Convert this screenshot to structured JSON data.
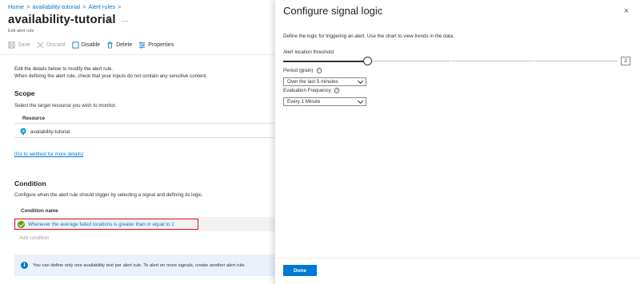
{
  "breadcrumb": {
    "items": [
      "Home",
      "availability-tutorial",
      "Alert rules"
    ],
    "sep": ">"
  },
  "page": {
    "title": "availability-tutorial",
    "subtitle": "Edit alert rule",
    "pin_icon": "pin-icon",
    "more_icon": "ellipsis-icon",
    "more_label": "···"
  },
  "toolbar": {
    "save_label": "Save",
    "discard_label": "Discard",
    "disable_label": "Disable",
    "delete_label": "Delete",
    "properties_label": "Properties"
  },
  "intro": {
    "line1": "Edit the details below to modify the alert rule.",
    "line2": "When defining the alert rule, check that your inputs do not contain any sensitive content."
  },
  "scope": {
    "heading": "Scope",
    "description": "Select the target resource you wish to monitor.",
    "resource_header": "Resource",
    "resource_name": "availability-tutorial",
    "resource_icon": "app-insights-icon"
  },
  "webtest_link": "[Go to webtest for more details]",
  "condition": {
    "heading": "Condition",
    "description": "Configure when the alert rule should trigger by selecting a signal and defining its logic.",
    "column_header": "Condition name",
    "row_text": "Whenever the average failed locations is greater than or equal to 2",
    "add_label": "Add condition"
  },
  "info_bar": {
    "text": "You can define only one availability test per alert rule. To alert on more signals, create another alert rule."
  },
  "panel": {
    "title": "Configure signal logic",
    "close_label": "×",
    "description": "Define the logic for triggering an alert. Use the chart to view trends in the data.",
    "threshold_label": "Alert location threshold",
    "threshold_value": "2",
    "threshold_fraction": 0.25,
    "period_label": "Period (grain)",
    "period_value": "Over the last 5 minutes",
    "eval_label": "Evaluation Frequency",
    "eval_value": "Every 1 Minute",
    "info_glyph": "i",
    "done_label": "Done"
  },
  "colors": {
    "accent": "#0078d4",
    "success": "#57a300",
    "highlight_border": "#e81123",
    "info_bg": "#eaf1fa"
  }
}
